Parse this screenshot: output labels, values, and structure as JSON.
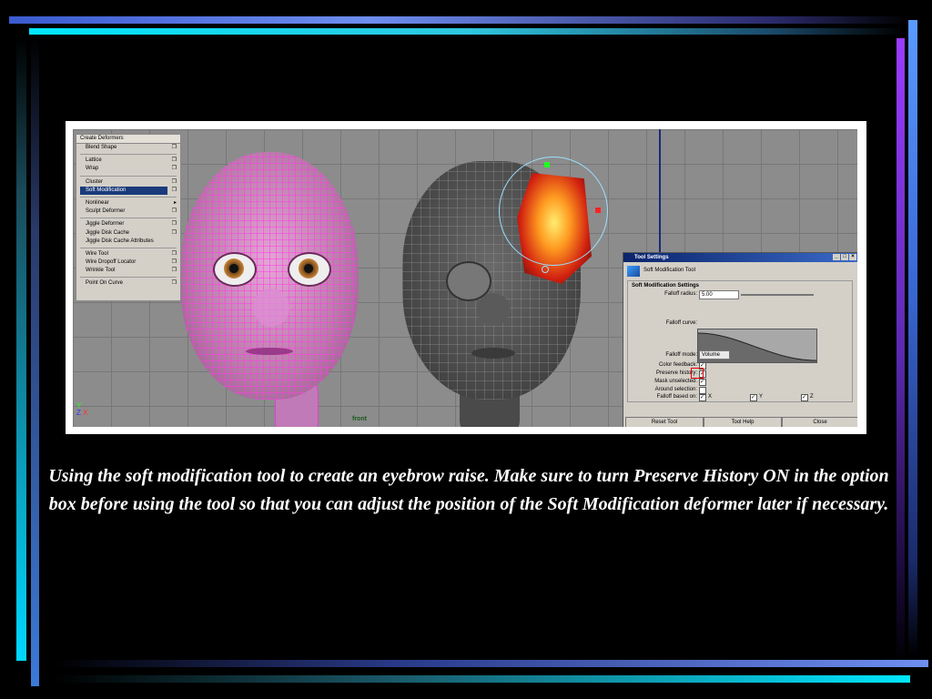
{
  "menu": {
    "title": "Create Deformers",
    "groups": [
      [
        {
          "label": "Blend Shape",
          "opt": "❐"
        }
      ],
      [
        {
          "label": "Lattice",
          "opt": "❐"
        },
        {
          "label": "Wrap",
          "opt": "❐"
        }
      ],
      [
        {
          "label": "Cluster",
          "opt": "❐"
        },
        {
          "label": "Soft Modification",
          "opt": "❐",
          "selected": true
        }
      ],
      [
        {
          "label": "Nonlinear",
          "opt": "▸"
        },
        {
          "label": "Sculpt Deformer",
          "opt": "❐"
        }
      ],
      [
        {
          "label": "Jiggle Deformer",
          "opt": "❐"
        },
        {
          "label": "Jiggle Disk Cache",
          "opt": "❐"
        },
        {
          "label": "Jiggle Disk Cache Attributes",
          "opt": ""
        }
      ],
      [
        {
          "label": "Wire Tool",
          "opt": "❐"
        },
        {
          "label": "Wire Dropoff Locator",
          "opt": "❐"
        },
        {
          "label": "Wrinkle Tool",
          "opt": "❐"
        }
      ],
      [
        {
          "label": "Point On Curve",
          "opt": "❐"
        }
      ]
    ]
  },
  "viewport": {
    "view_label": "front",
    "axis_y": "Y",
    "axis_z": "Z",
    "axis_x": "X"
  },
  "tool_settings": {
    "title": "Tool Settings",
    "tool_name": "Soft Modification Tool",
    "section": "Soft Modification Settings",
    "falloff_radius_label": "Falloff radius:",
    "falloff_radius_value": "5.00",
    "falloff_curve_label": "Falloff curve:",
    "falloff_mode_label": "Falloff mode:",
    "falloff_mode_value": "Volume",
    "color_feedback_label": "Color feedback:",
    "preserve_history_label": "Preserve history:",
    "mask_unselected_label": "Mask unselected:",
    "around_selection_label": "Around selection:",
    "falloff_based_on_label": "Falloff based on:",
    "axis_x": "X",
    "axis_y": "Y",
    "axis_z": "Z",
    "buttons": {
      "reset": "Reset Tool",
      "help": "Tool Help",
      "close": "Close"
    },
    "window_buttons": {
      "minimize": "_",
      "maximize": "□",
      "close": "×"
    }
  },
  "caption": "Using the soft modification tool to create an eyebrow raise. Make sure to turn Preserve History ON in the option box before using the tool so that you can adjust the position of the Soft Modification deformer later if necessary.",
  "colors": {
    "highlight_box": "#e00000",
    "menu_selected": "#1a3a7a",
    "title_bar": "#0a246a"
  }
}
